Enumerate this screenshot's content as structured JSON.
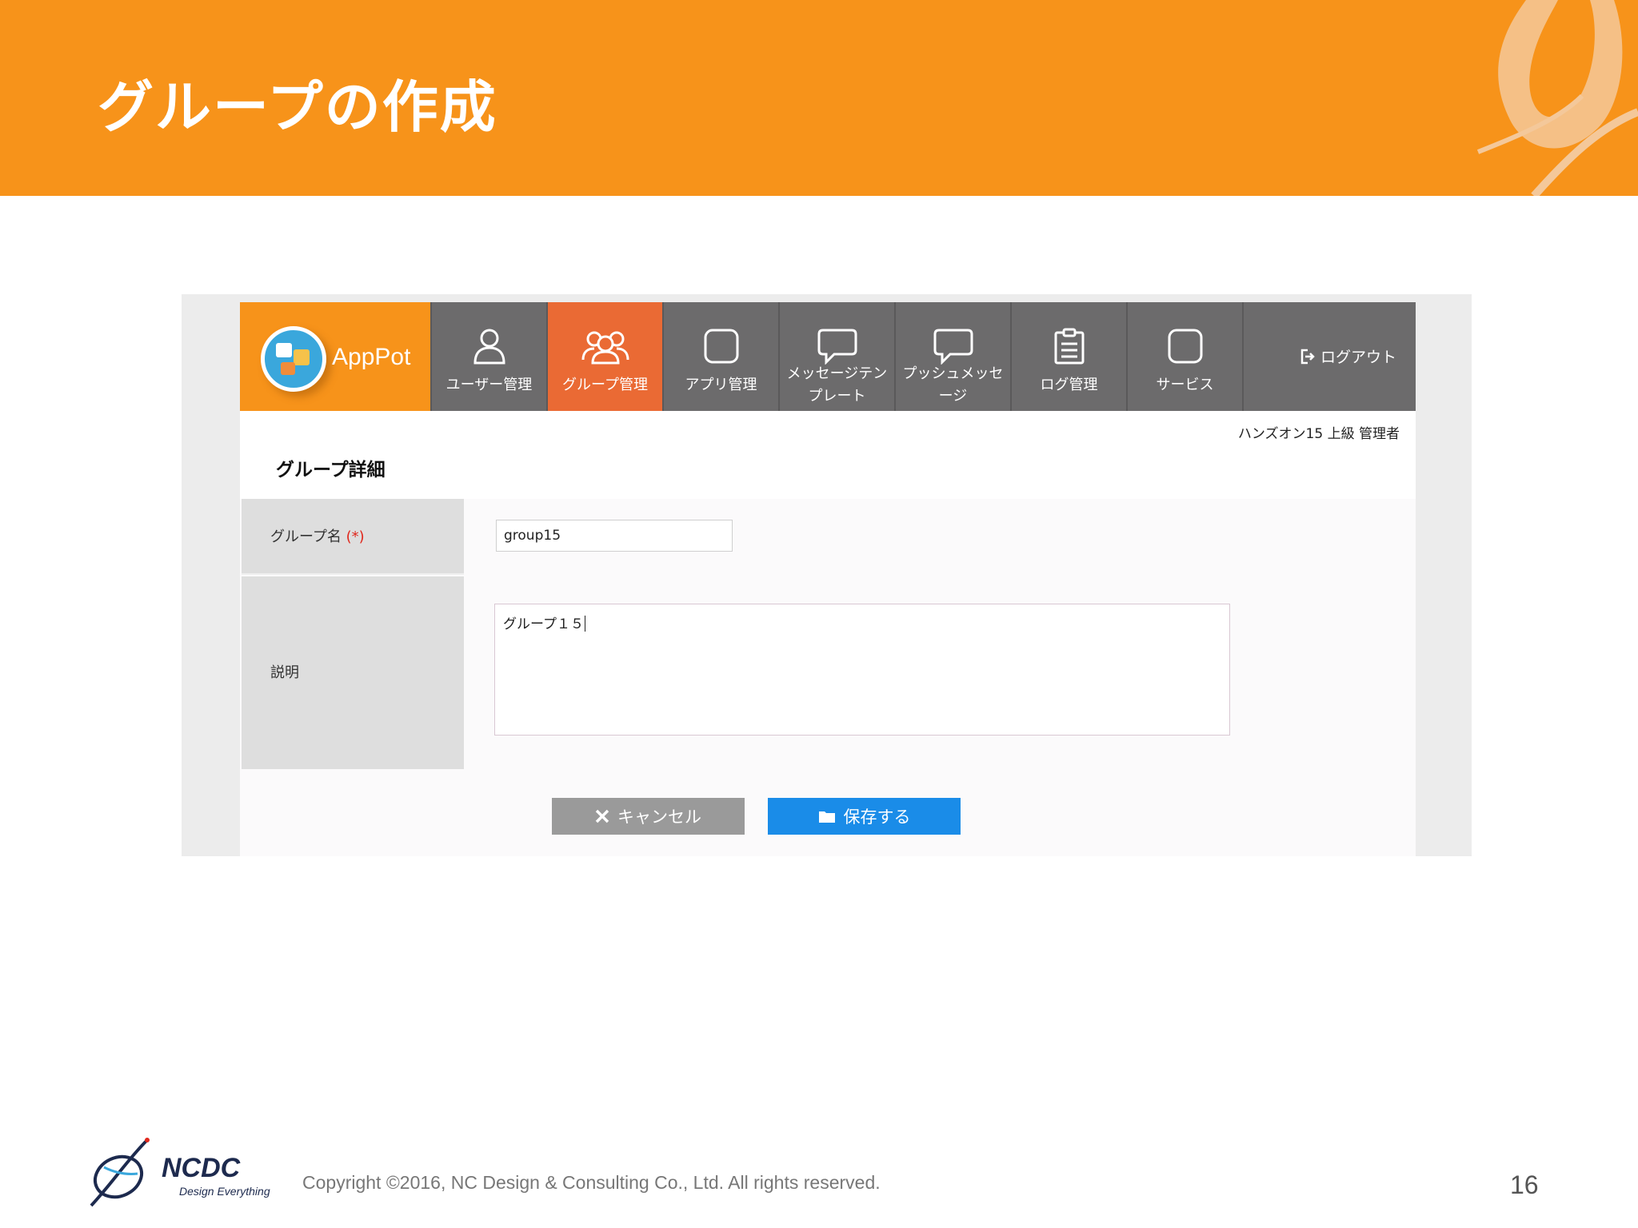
{
  "slide": {
    "title": "グループの作成",
    "copyright": "Copyright ©2016, NC Design & Consulting Co., Ltd. All rights reserved.",
    "page_number": "16",
    "brand": {
      "name": "NCDC",
      "tagline": "Design Everything"
    },
    "colors": {
      "header": "#f7931a",
      "active_tab": "#ea6a34",
      "navbar": "#6c6b6c",
      "save_button": "#1a8ce8"
    }
  },
  "app": {
    "logo_text": "AppPot",
    "nav": [
      {
        "label": "ユーザー管理",
        "icon": "user-icon"
      },
      {
        "label": "グループ管理",
        "icon": "group-icon",
        "active": true
      },
      {
        "label": "アプリ管理",
        "icon": "app-square-icon"
      },
      {
        "label": "メッセージテンプレート",
        "icon": "speech-bubble-icon"
      },
      {
        "label": "プッシュメッセージ",
        "icon": "speech-bubble-icon"
      },
      {
        "label": "ログ管理",
        "icon": "clipboard-icon"
      },
      {
        "label": "サービス",
        "icon": "service-square-icon"
      }
    ],
    "logout_label": "ログアウト",
    "user_info": "ハンズオン15 上級 管理者",
    "section_title": "グループ詳細",
    "form": {
      "group_name_label": "グループ名",
      "required_mark": "(*)",
      "group_name_value": "group15",
      "description_label": "説明",
      "description_value": "グループ１５"
    },
    "buttons": {
      "cancel": "キャンセル",
      "save": "保存する"
    }
  }
}
